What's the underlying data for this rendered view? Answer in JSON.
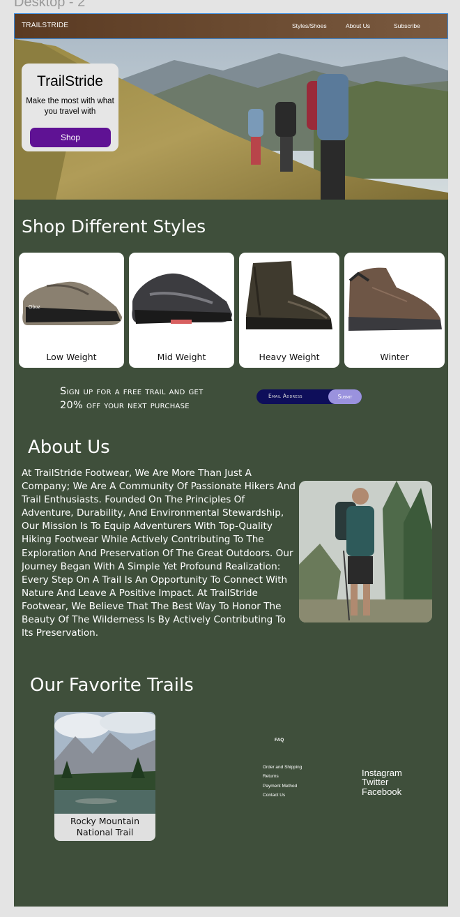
{
  "frame": {
    "label": "Desktop - 2"
  },
  "nav": {
    "brand": "TRAILSTRIDE",
    "links": [
      "Styles/Shoes",
      "About Us",
      "Subscribe"
    ]
  },
  "hero": {
    "title": "TrailStride",
    "subtitle": "Make the most with what you travel with",
    "button": "Shop"
  },
  "styles": {
    "title": "Shop Different Styles",
    "items": [
      "Low Weight",
      "Mid Weight",
      "Heavy Weight",
      "Winter"
    ]
  },
  "signup": {
    "text_line1": "Sign up for a free trail and get",
    "text_line2": "20% off your next purchase",
    "email_placeholder": "Email Address",
    "submit": "Submit"
  },
  "about": {
    "title": "About Us",
    "body": "At TrailStride Footwear, We Are More Than Just A Company; We Are A Community Of Passionate Hikers And Trail Enthusiasts. Founded On The Principles Of Adventure, Durability, And Environmental Stewardship, Our Mission Is To Equip Adventurers With Top-Quality Hiking Footwear While Actively Contributing To The Exploration And Preservation Of The Great Outdoors. Our Journey Began With A Simple Yet Profound Realization: Every Step On A Trail Is An Opportunity To Connect With Nature And Leave A Positive Impact. At TrailStride Footwear, We Believe That The Best Way To Honor The Beauty Of The Wilderness Is By Actively Contributing To Its Preservation."
  },
  "trails": {
    "title": "Our Favorite Trails",
    "items": [
      {
        "name_line1": "Rocky Mountain",
        "name_line2": "National Trail"
      }
    ]
  },
  "footer": {
    "faq_title": "FAQ",
    "faq_links": [
      "Order and Shipping",
      "Returns",
      "Payment Method",
      "Contact Us"
    ],
    "social": [
      "Instagram",
      "Twitter",
      "Facebook"
    ]
  },
  "colors": {
    "page_bg": "#3f4f3b",
    "nav_brown": "#6a4a30",
    "shop_button": "#5f1294",
    "signup_bar": "#0e0e5a",
    "submit_button": "#9a92de",
    "selection_outline": "#3b8de0"
  }
}
